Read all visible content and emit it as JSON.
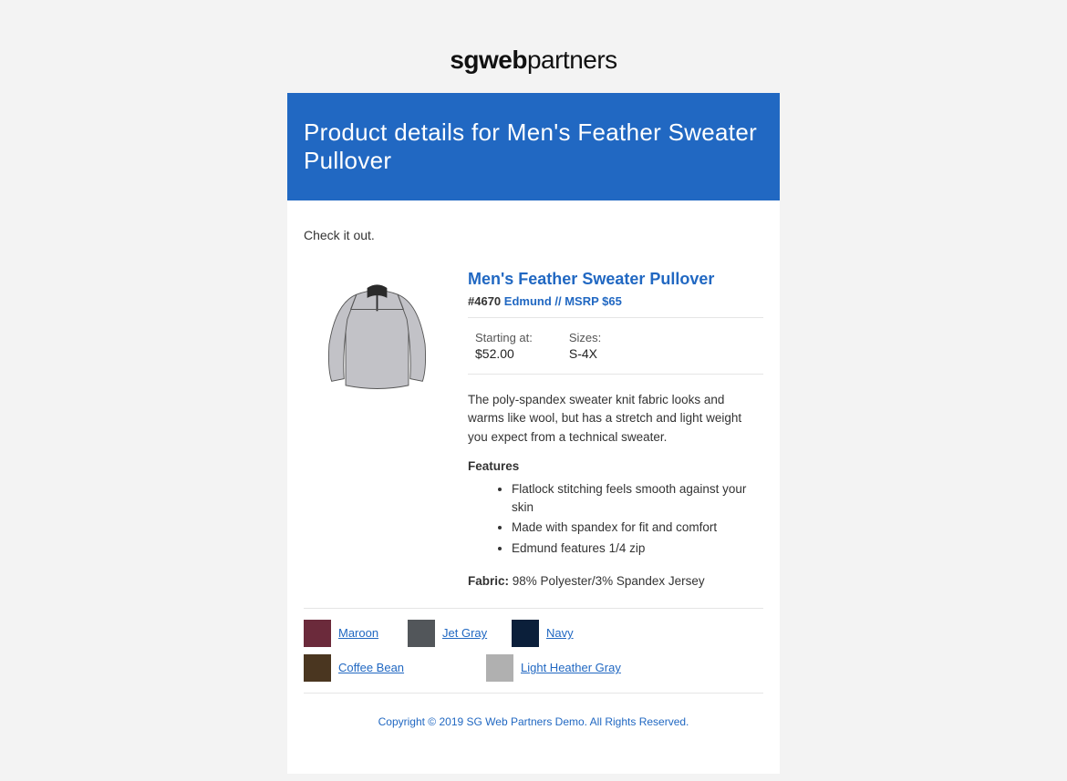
{
  "logo": {
    "bold": "sgweb",
    "light": "partners"
  },
  "page_header": "Product details for Men's Feather Sweater Pullover",
  "intro": "Check it out.",
  "product": {
    "title": "Men's Feather Sweater Pullover",
    "sku_code": "#4670",
    "sku_rest": "Edmund // MSRP $65",
    "starting_label": "Starting at:",
    "starting_value": "$52.00",
    "sizes_label": "Sizes:",
    "sizes_value": "S-4X",
    "description": "The poly-spandex sweater knit fabric looks and warms like wool, but has a stretch and light weight you expect from a technical sweater.",
    "features_head": "Features",
    "features": [
      "Flatlock stitching feels smooth against your skin",
      "Made with spandex for fit and comfort",
      "Edmund features 1/4 zip"
    ],
    "fabric_label": "Fabric:",
    "fabric_value": "98% Polyester/3% Spandex Jersey"
  },
  "colors": [
    {
      "name": "Maroon",
      "hex": "#6b2a3b"
    },
    {
      "name": "Jet Gray",
      "hex": "#52565a"
    },
    {
      "name": "Navy",
      "hex": "#0b1f3a"
    },
    {
      "name": "Coffee Bean",
      "hex": "#4a3620"
    },
    {
      "name": "Light Heather Gray",
      "hex": "#b0b0b0"
    }
  ],
  "footer": "Copyright © 2019 SG Web Partners Demo. All Rights Reserved."
}
